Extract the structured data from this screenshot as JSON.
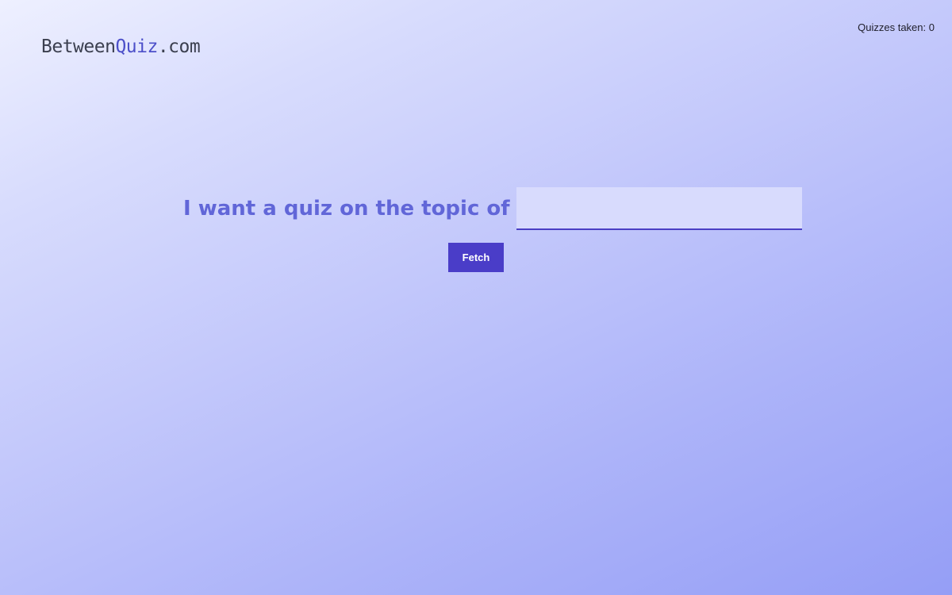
{
  "header": {
    "logo_part1": "Between",
    "logo_part2": "Quiz",
    "logo_part3": ".com",
    "quizzes_taken_label": "Quizzes taken:",
    "quizzes_taken_count": "0"
  },
  "main": {
    "prompt": "I want a quiz on the topic of",
    "topic_input_value": "",
    "topic_input_placeholder": "",
    "fetch_label": "Fetch"
  },
  "colors": {
    "accent": "#4a3dc8",
    "prompt_text": "#6166d8",
    "input_bg": "#d8dbfd"
  }
}
